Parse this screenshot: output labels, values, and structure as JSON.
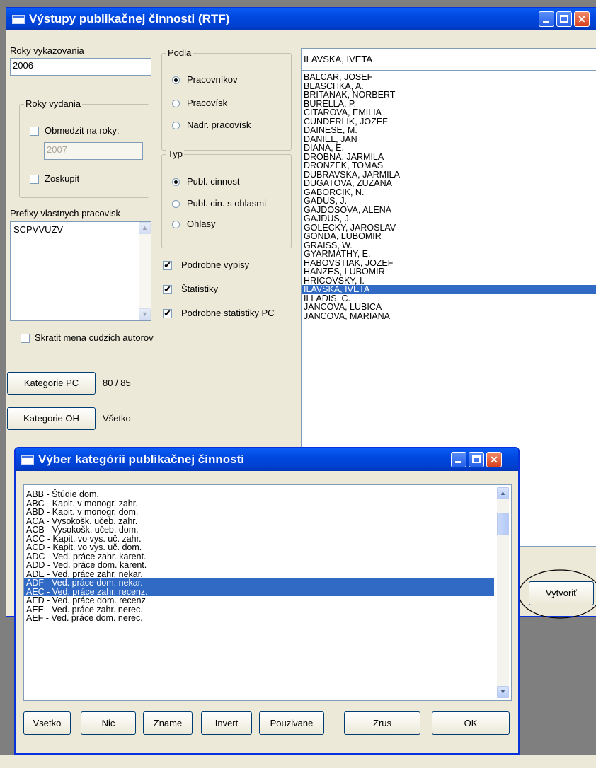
{
  "main_window": {
    "title": "Výstupy publikačnej činnosti (RTF)",
    "roky_vykazovania_label": "Roky vykazovania",
    "roky_vykazovania_value": "2006",
    "roky_vydania_group": "Roky vydania",
    "obmedzit_label": "Obmedzit na roky:",
    "obmedzit_checked": false,
    "obmedzit_value": "2007",
    "zoskupit_label": "Zoskupit",
    "zoskupit_checked": false,
    "prefixy_label": "Prefixy vlastnych pracovisk",
    "prefixy_value": "SCPVVUZV",
    "skratit_label": "Skratit mena cudzich autorov",
    "skratit_checked": false,
    "kategorie_pc_button": "Kategorie PC",
    "kategorie_pc_value": "80 / 85",
    "kategorie_oh_button": "Kategorie OH",
    "kategorie_oh_value": "Všetko",
    "podla_group": "Podla",
    "podla_options": [
      "Pracovníkov",
      "Pracovísk",
      "Nadr. pracovísk"
    ],
    "podla_selected": "Pracovníkov",
    "typ_group": "Typ",
    "typ_options": [
      "Publ. cinnost",
      "Publ. cin. s ohlasmi",
      "Ohlasy"
    ],
    "typ_selected": "Publ. cinnost",
    "podrobne_vypisy_label": "Podrobne vypisy",
    "podrobne_vypisy_checked": true,
    "statistiky_label": "Štatistiky",
    "statistiky_checked": true,
    "podrobne_statistiky_label": "Podrobne statistiky PC",
    "podrobne_statistiky_checked": true,
    "selected_person": "ILAVSKA, IVETA",
    "persons": [
      "BALCAR, JOSEF",
      "BLASCHKA, A.",
      "BRITANAK, NORBERT",
      "BURELLA, P.",
      "CITAROVA, EMILIA",
      "CUNDERLIK, JOZEF",
      "DAINESE, M.",
      "DANIEL, JAN",
      "DIANA, E.",
      "DROBNA, JARMILA",
      "DRONZEK, TOMAS",
      "DUBRAVSKA, JARMILA",
      "DUGATOVA, ZUZANA",
      "GABORCIK, N.",
      "GADUS, J.",
      "GAJDOSOVA, ALENA",
      "GAJDUS, J.",
      "GOLECKY, JAROSLAV",
      "GONDA, LUBOMIR",
      "GRAISS, W.",
      "GYARMATHY, E.",
      "HABOVSTIAK, JOZEF",
      "HANZES, LUBOMIR",
      "HRICOVSKY, I.",
      "ILAVSKA, IVETA",
      "ILLADIS, C.",
      "JANCOVA, LUBICA",
      "JANCOVA, MARIANA"
    ],
    "vytvorit_button": "Vytvoriť"
  },
  "dialog": {
    "title": "Výber kategórii publikačnej činnosti",
    "categories": [
      "ABB - Štúdie dom.",
      "ABC - Kapit. v monogr. zahr.",
      "ABD - Kapit. v monogr. dom.",
      "ACA - Vysokošk. učeb. zahr.",
      "ACB - Vysokošk. učeb. dom.",
      "ACC - Kapit. vo vys. uč. zahr.",
      "ACD - Kapit. vo vys. uč. dom.",
      "ADC - Ved. práce zahr. karent.",
      "ADD - Ved. práce dom. karent.",
      "ADE - Ved. práce zahr. nekar.",
      "ADF - Ved. práce dom. nekar.",
      "AEC - Ved. práce zahr. recenz.",
      "AED - Ved. práce dom. recenz.",
      "AEE - Ved. práce zahr. nerec.",
      "AEF - Ved. práce dom. nerec."
    ],
    "selected_categories": [
      "ADF - Ved. práce dom. nekar.",
      "AEC - Ved. práce zahr. recenz."
    ],
    "buttons": {
      "vsetko": "Vsetko",
      "nic": "Nic",
      "zname": "Zname",
      "invert": "Invert",
      "pouzivane": "Pouzivane",
      "zrus": "Zrus",
      "ok": "OK"
    }
  }
}
